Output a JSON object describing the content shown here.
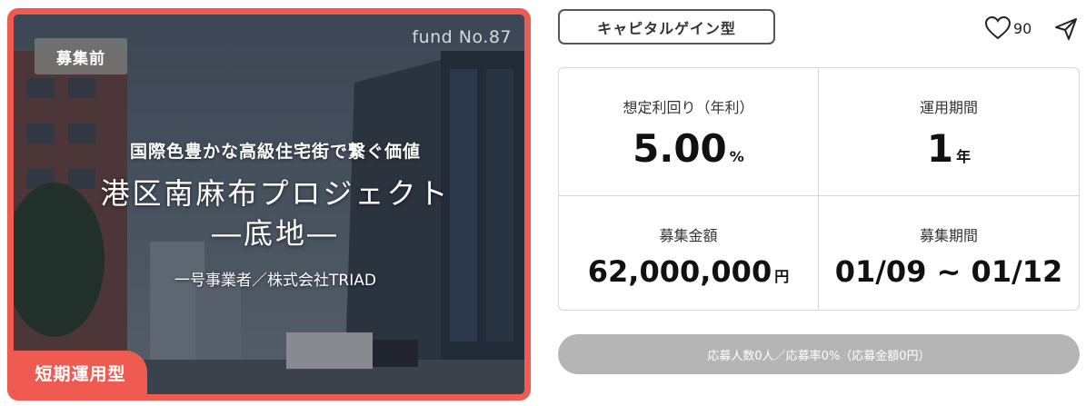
{
  "card": {
    "fund_no": "fund No.87",
    "status_badge": "募集前",
    "catchphrase": "国際色豊かな高級住宅街で繋ぐ価値",
    "title_line1": "港区南麻布プロジェクト",
    "title_line2": "―底地―",
    "operator": "一号事業者／株式会社TRIAD",
    "type_tag": "短期運用型"
  },
  "header": {
    "category": "キャピタルゲイン型",
    "like_count": "90",
    "icons": [
      "heart-icon",
      "share-icon"
    ]
  },
  "metrics": {
    "yield_label": "想定利回り（年利）",
    "yield_value": "5.00",
    "yield_unit": "%",
    "period_label": "運用期間",
    "period_value": "1",
    "period_unit": "年",
    "amount_label": "募集金額",
    "amount_value": "62,000,000",
    "amount_unit": "円",
    "recruit_label": "募集期間",
    "recruit_value": "01/09 ~ 01/12"
  },
  "apply_bar": "応募人数0人／応募率0%（応募金額0円）",
  "colors": {
    "accent": "#ef5b51",
    "disabled": "#b5b5b5"
  }
}
